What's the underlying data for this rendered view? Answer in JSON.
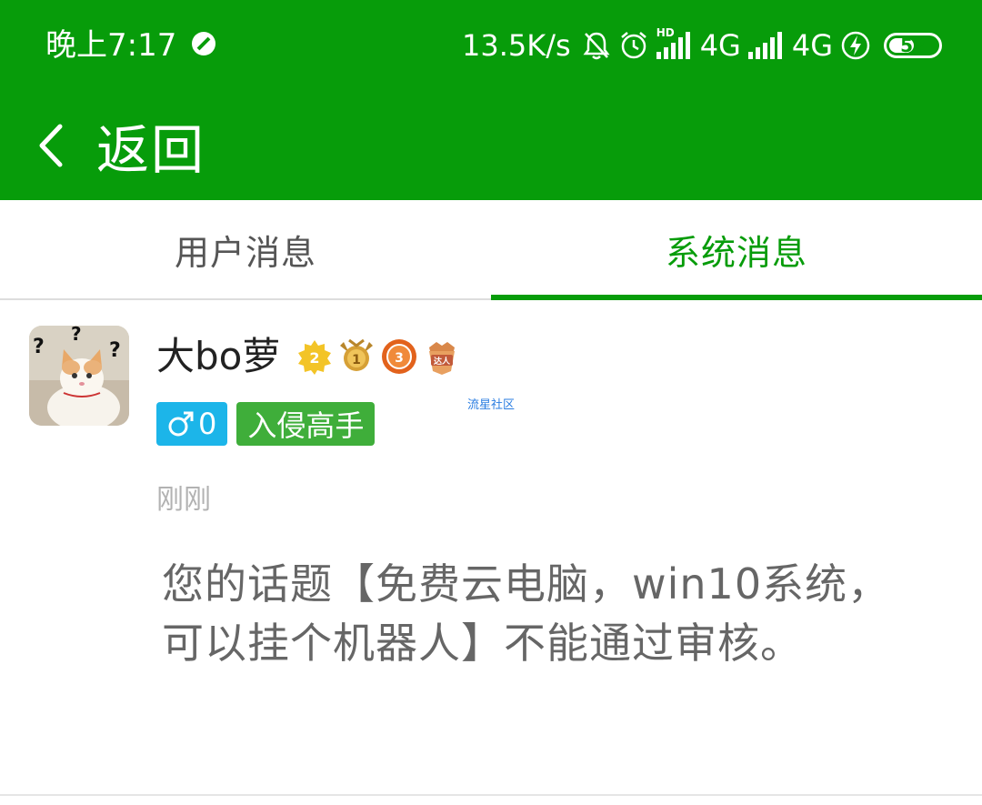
{
  "status_bar": {
    "time": "晚上7:17",
    "net_speed": "13.5K/s",
    "sim1_type": "4G",
    "sim1_hd": "HD",
    "sim2_type": "4G",
    "battery": "52",
    "battery_level_percent": 52,
    "icons": [
      "do-not-disturb-icon",
      "bell-mute-icon",
      "alarm-icon",
      "signal-icon",
      "signal-icon",
      "charging-icon",
      "battery-icon"
    ]
  },
  "nav": {
    "back_label": "返回"
  },
  "tabs": [
    {
      "label": "用户消息",
      "active": false
    },
    {
      "label": "系统消息",
      "active": true
    }
  ],
  "colors": {
    "primary": "#079c0a",
    "gender_tag": "#1cb5e9",
    "title_tag": "#3fae3a"
  },
  "message": {
    "username": "大bo萝",
    "badges": [
      "level-2-badge",
      "rank-1-medal",
      "level-3-medal",
      "expert-medal"
    ],
    "gender_tag": "0",
    "title_tag": "入侵高手",
    "watermark": "流星社区",
    "time": "刚刚",
    "content": "您的话题【免费云电脑，win10系统，可以挂个机器人】不能通过审核。"
  }
}
